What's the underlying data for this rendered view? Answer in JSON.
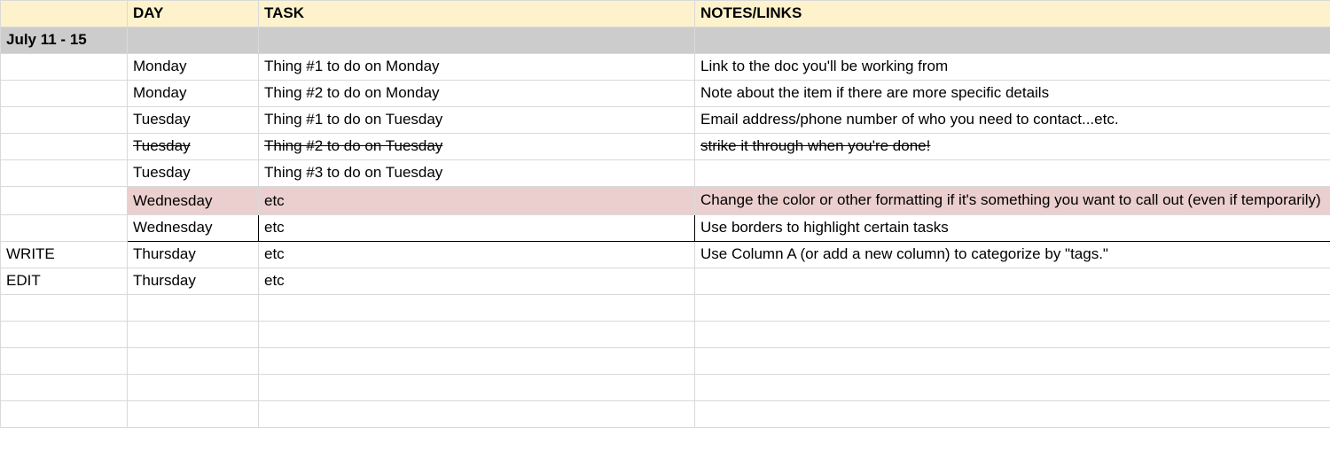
{
  "headers": {
    "tag": "",
    "day": "DAY",
    "task": "TASK",
    "notes": "NOTES/LINKS"
  },
  "week_label": "July 11 - 15",
  "rows": [
    {
      "tag": "",
      "day": "Monday",
      "task": "Thing #1 to do on Monday",
      "notes": "Link to the doc you'll be working from",
      "style": ""
    },
    {
      "tag": "",
      "day": "Monday",
      "task": "Thing #2 to do on Monday",
      "notes": "Note about the item if there are more specific details",
      "style": ""
    },
    {
      "tag": "",
      "day": "Tuesday",
      "task": "Thing #1 to do on Tuesday",
      "notes": "Email address/phone number of who you need to contact...etc.",
      "style": ""
    },
    {
      "tag": "",
      "day": "Tuesday",
      "task": "Thing #2 to do on Tuesday",
      "notes": "strike it through when you're done!",
      "style": "strike"
    },
    {
      "tag": "",
      "day": "Tuesday",
      "task": "Thing #3 to do on Tuesday",
      "notes": "",
      "style": ""
    },
    {
      "tag": "",
      "day": "Wednesday",
      "task": "etc",
      "notes": "Change the color or other formatting if it's something you want to call out (even if temporarily)",
      "style": "pink"
    },
    {
      "tag": "",
      "day": "Wednesday",
      "task": "etc",
      "notes": "Use borders to highlight certain tasks",
      "style": "bordered"
    },
    {
      "tag": "WRITE",
      "day": "Thursday",
      "task": "etc",
      "notes": "Use Column A (or add a new column) to categorize by \"tags.\"",
      "style": ""
    },
    {
      "tag": "EDIT",
      "day": "Thursday",
      "task": "etc",
      "notes": "",
      "style": ""
    },
    {
      "tag": "",
      "day": "",
      "task": "",
      "notes": "",
      "style": ""
    },
    {
      "tag": "",
      "day": "",
      "task": "",
      "notes": "",
      "style": ""
    },
    {
      "tag": "",
      "day": "",
      "task": "",
      "notes": "",
      "style": ""
    },
    {
      "tag": "",
      "day": "",
      "task": "",
      "notes": "",
      "style": ""
    },
    {
      "tag": "",
      "day": "",
      "task": "",
      "notes": "",
      "style": ""
    }
  ]
}
